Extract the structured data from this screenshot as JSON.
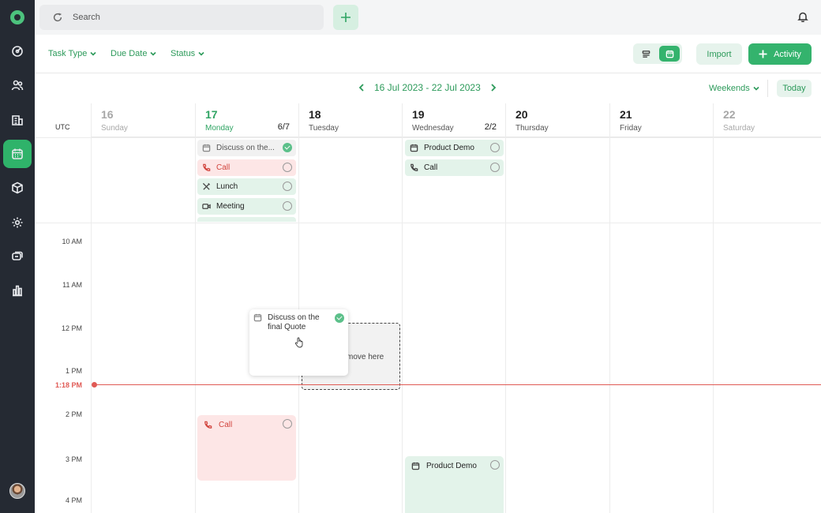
{
  "search": {
    "placeholder": "Search"
  },
  "filters": [
    {
      "label": "Task Type"
    },
    {
      "label": "Due Date"
    },
    {
      "label": "Status"
    }
  ],
  "actions": {
    "import_label": "Import",
    "activity_label": "Activity"
  },
  "calendar": {
    "range": "16 Jul 2023 - 22 Jul 2023",
    "weekends_label": "Weekends",
    "today_label": "Today",
    "timezone": "UTC",
    "days": [
      {
        "num": "16",
        "name": "Sunday",
        "count": ""
      },
      {
        "num": "17",
        "name": "Monday",
        "count": "6/7"
      },
      {
        "num": "18",
        "name": "Tuesday",
        "count": ""
      },
      {
        "num": "19",
        "name": "Wednesday",
        "count": "2/2"
      },
      {
        "num": "20",
        "name": "Thursday",
        "count": ""
      },
      {
        "num": "21",
        "name": "Friday",
        "count": ""
      },
      {
        "num": "22",
        "name": "Saturday",
        "count": ""
      }
    ],
    "times": [
      "10 AM",
      "11 AM",
      "12 PM",
      "1 PM",
      "2 PM",
      "3 PM",
      "4 PM"
    ],
    "now_label": "1:18 PM"
  },
  "allday_events": {
    "monday": [
      {
        "title": "Discuss on the...",
        "type": "calendar",
        "status": "done"
      },
      {
        "title": "Call",
        "type": "phone",
        "status": "open"
      },
      {
        "title": "Lunch",
        "type": "lunch",
        "status": "open"
      },
      {
        "title": "Meeting",
        "type": "video",
        "status": "open"
      }
    ],
    "wednesday": [
      {
        "title": "Product Demo",
        "type": "calendar",
        "status": "open"
      },
      {
        "title": "Call",
        "type": "phone",
        "status": "open"
      }
    ]
  },
  "timed_events": {
    "monday_call": {
      "title": "Call"
    },
    "wednesday_demo": {
      "title": "Product Demo"
    }
  },
  "drag": {
    "card_title": "Discuss on the final Quote",
    "drop_hint": "move here"
  },
  "colors": {
    "accent": "#34b36d",
    "now": "#e05a55",
    "sidebar": "#252a33"
  }
}
